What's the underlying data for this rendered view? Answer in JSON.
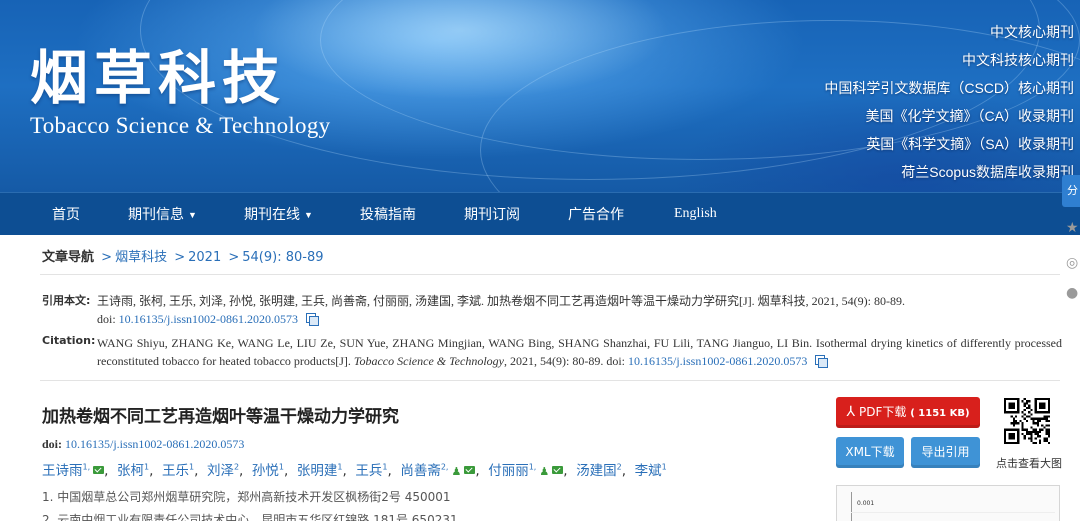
{
  "banner": {
    "logo_cn": "烟草科技",
    "logo_en": "Tobacco Science & Technology",
    "indexing": [
      "中文核心期刊",
      "中文科技核心期刊",
      "中国科学引文数据库（CSCD）核心期刊",
      "美国《化学文摘》（CA）收录期刊",
      "英国《科学文摘》（SA）收录期刊",
      "荷兰Scopus数据库收录期刊"
    ]
  },
  "nav": {
    "items": [
      "首页",
      "期刊信息",
      "期刊在线",
      "投稿指南",
      "期刊订阅",
      "广告合作",
      "English"
    ]
  },
  "side_tools": {
    "share_label": "分"
  },
  "breadcrumb": {
    "label": "文章导航",
    "journal": "烟草科技",
    "year": "2021",
    "issue": "54(9): 80-89"
  },
  "citation_cn": {
    "label": "引用本文:",
    "text": "王诗雨, 张柯, 王乐, 刘泽, 孙悦, 张明建, 王兵, 尚善斋, 付丽丽, 汤建国, 李斌. 加热卷烟不同工艺再造烟叶等温干燥动力学研究[J]. 烟草科技, 2021, 54(9): 80-89.",
    "doi_prefix": "doi:",
    "doi": "10.16135/j.issn1002-0861.2020.0573"
  },
  "citation_en": {
    "label": "Citation:",
    "text_main": "WANG Shiyu, ZHANG Ke, WANG Le, LIU Ze, SUN Yue, ZHANG Mingjian, WANG Bing, SHANG Shanzhai, FU Lili, TANG Jianguo, LI Bin. Isothermal drying kinetics of differently processed reconstituted tobacco for heated tobacco products[J]. ",
    "journal": "Tobacco Science & Technology",
    "text_tail": ", 2021, 54(9): 80-89. doi: ",
    "doi": "10.16135/j.issn1002-0861.2020.0573"
  },
  "article": {
    "title": "加热卷烟不同工艺再造烟叶等温干燥动力学研究",
    "doi_label": "doi:",
    "doi": "10.16135/j.issn1002-0861.2020.0573",
    "authors": [
      {
        "name": "王诗雨",
        "sup": "1,"
      },
      {
        "name": "张柯",
        "sup": "1"
      },
      {
        "name": "王乐",
        "sup": "1"
      },
      {
        "name": "刘泽",
        "sup": "2"
      },
      {
        "name": "孙悦",
        "sup": "1"
      },
      {
        "name": "张明建",
        "sup": "1"
      },
      {
        "name": "王兵",
        "sup": "1"
      },
      {
        "name": "尚善斋",
        "sup": "2,"
      },
      {
        "name": "付丽丽",
        "sup": "1,"
      },
      {
        "name": "汤建国",
        "sup": "2"
      },
      {
        "name": "李斌",
        "sup": "1"
      }
    ],
    "affiliations": [
      "1.  中国烟草总公司郑州烟草研究院，郑州高新技术开发区枫杨街2号    450001",
      "2.  云南中烟工业有限责任公司技术中心，昆明市五华区红锦路 181号    650231"
    ]
  },
  "actions": {
    "pdf_label": "PDF下载",
    "pdf_size": "( 1151 KB)",
    "xml_label": "XML下载",
    "export_label": "导出引用",
    "qr_caption": "点击查看大图"
  },
  "thumbnail": {
    "tick_label": "0.001"
  },
  "colors": {
    "nav_bg": "#0d4e93",
    "link": "#2a6fb8",
    "pdf_button": "#d8201c",
    "action_button": "#3f93d6"
  }
}
